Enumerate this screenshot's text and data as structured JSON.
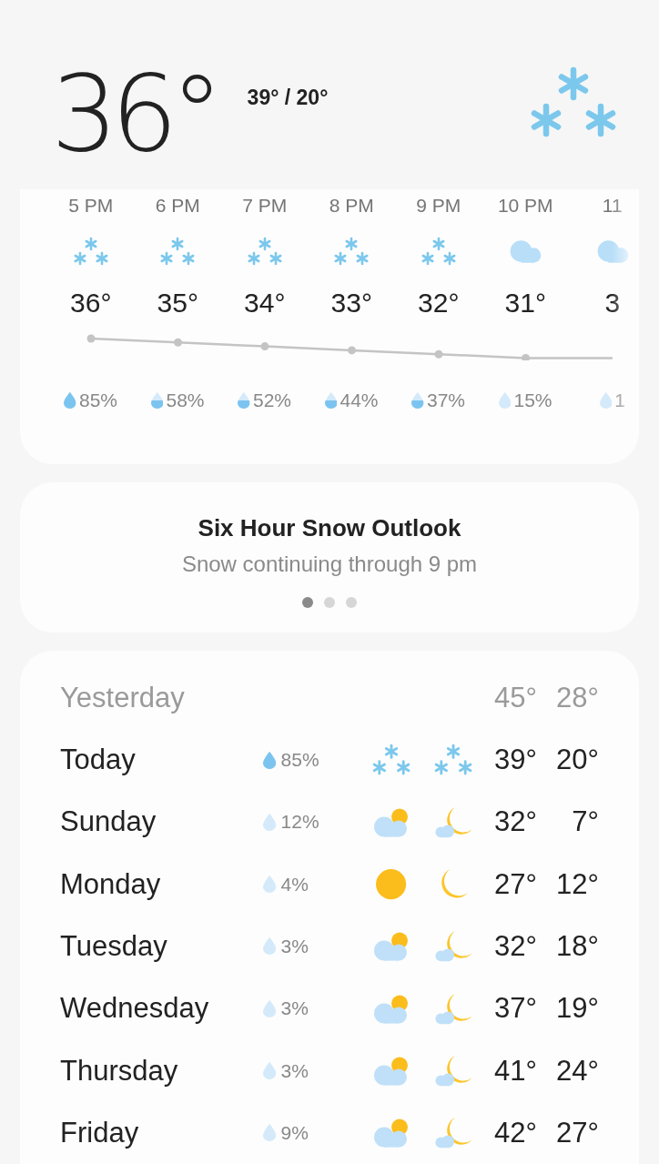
{
  "current": {
    "temperature": "36°",
    "high_low": "39° / 20°",
    "icon": {
      "kind": "snow"
    }
  },
  "hourly": [
    {
      "time": "5 PM",
      "icon": {
        "kind": "snow"
      },
      "temperature": "36°",
      "precipitation": "85%",
      "drop": {
        "kind": "full"
      }
    },
    {
      "time": "6 PM",
      "icon": {
        "kind": "snow"
      },
      "temperature": "35°",
      "precipitation": "58%",
      "drop": {
        "kind": "half"
      }
    },
    {
      "time": "7 PM",
      "icon": {
        "kind": "snow"
      },
      "temperature": "34°",
      "precipitation": "52%",
      "drop": {
        "kind": "half"
      }
    },
    {
      "time": "8 PM",
      "icon": {
        "kind": "snow"
      },
      "temperature": "33°",
      "precipitation": "44%",
      "drop": {
        "kind": "half"
      }
    },
    {
      "time": "9 PM",
      "icon": {
        "kind": "snow"
      },
      "temperature": "32°",
      "precipitation": "37%",
      "drop": {
        "kind": "half"
      }
    },
    {
      "time": "10 PM",
      "icon": {
        "kind": "cloud"
      },
      "temperature": "31°",
      "precipitation": "15%",
      "drop": {
        "kind": "empty"
      }
    },
    {
      "time": "11",
      "icon": {
        "kind": "cloud"
      },
      "temperature": "3",
      "precipitation": "1",
      "drop": {
        "kind": "empty"
      }
    }
  ],
  "outlook": {
    "title": "Six Hour Snow Outlook",
    "subtitle": "Snow continuing through 9 pm",
    "pages": [
      {
        "selected": true
      },
      {
        "selected": false
      },
      {
        "selected": false
      }
    ]
  },
  "yesterday": {
    "label": "Yesterday",
    "high": "45°",
    "low": "28°"
  },
  "daily": [
    {
      "day": "Today",
      "precipitation": "85%",
      "drop": {
        "kind": "full"
      },
      "day_icon": {
        "kind": "snow"
      },
      "night_icon": {
        "kind": "snow"
      },
      "high": "39°",
      "low": "20°"
    },
    {
      "day": "Sunday",
      "precipitation": "12%",
      "drop": {
        "kind": "empty"
      },
      "day_icon": {
        "kind": "partly-cloudy"
      },
      "night_icon": {
        "kind": "moon-cloud"
      },
      "high": "32°",
      "low": "7°"
    },
    {
      "day": "Monday",
      "precipitation": "4%",
      "drop": {
        "kind": "empty"
      },
      "day_icon": {
        "kind": "sun"
      },
      "night_icon": {
        "kind": "moon"
      },
      "high": "27°",
      "low": "12°"
    },
    {
      "day": "Tuesday",
      "precipitation": "3%",
      "drop": {
        "kind": "empty"
      },
      "day_icon": {
        "kind": "partly-cloudy"
      },
      "night_icon": {
        "kind": "moon-cloud"
      },
      "high": "32°",
      "low": "18°"
    },
    {
      "day": "Wednesday",
      "precipitation": "3%",
      "drop": {
        "kind": "empty"
      },
      "day_icon": {
        "kind": "partly-cloudy"
      },
      "night_icon": {
        "kind": "moon-cloud"
      },
      "high": "37°",
      "low": "19°"
    },
    {
      "day": "Thursday",
      "precipitation": "3%",
      "drop": {
        "kind": "empty"
      },
      "day_icon": {
        "kind": "partly-cloudy"
      },
      "night_icon": {
        "kind": "moon-cloud"
      },
      "high": "41°",
      "low": "24°"
    },
    {
      "day": "Friday",
      "precipitation": "9%",
      "drop": {
        "kind": "empty"
      },
      "day_icon": {
        "kind": "partly-cloudy"
      },
      "night_icon": {
        "kind": "moon-cloud"
      },
      "high": "42°",
      "low": "27°"
    }
  ]
}
